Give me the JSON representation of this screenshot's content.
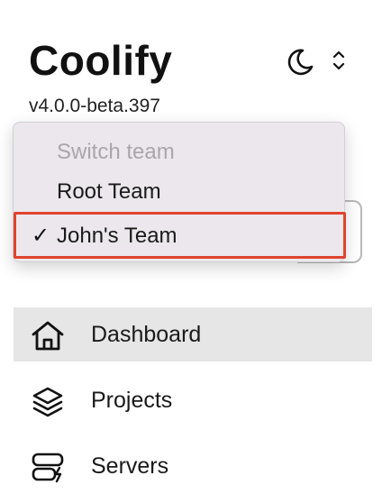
{
  "app": {
    "name": "Coolify",
    "version": "v4.0.0-beta.397"
  },
  "header": {
    "theme_icon": "moon-icon",
    "switcher_icon": "chevron-up-down-icon"
  },
  "team_dropdown": {
    "header": "Switch team",
    "items": [
      {
        "label": "Root Team",
        "selected": false
      },
      {
        "label": "John's Team",
        "selected": true
      }
    ],
    "check_mark": "✓"
  },
  "nav": {
    "items": [
      {
        "label": "Dashboard",
        "icon": "home-icon",
        "active": true
      },
      {
        "label": "Projects",
        "icon": "layers-icon",
        "active": false
      },
      {
        "label": "Servers",
        "icon": "server-icon",
        "active": false
      }
    ]
  },
  "colors": {
    "highlight_border": "#e0432e",
    "active_nav_bg": "#e6e6e6",
    "dropdown_bg": "#ebe7ec"
  }
}
